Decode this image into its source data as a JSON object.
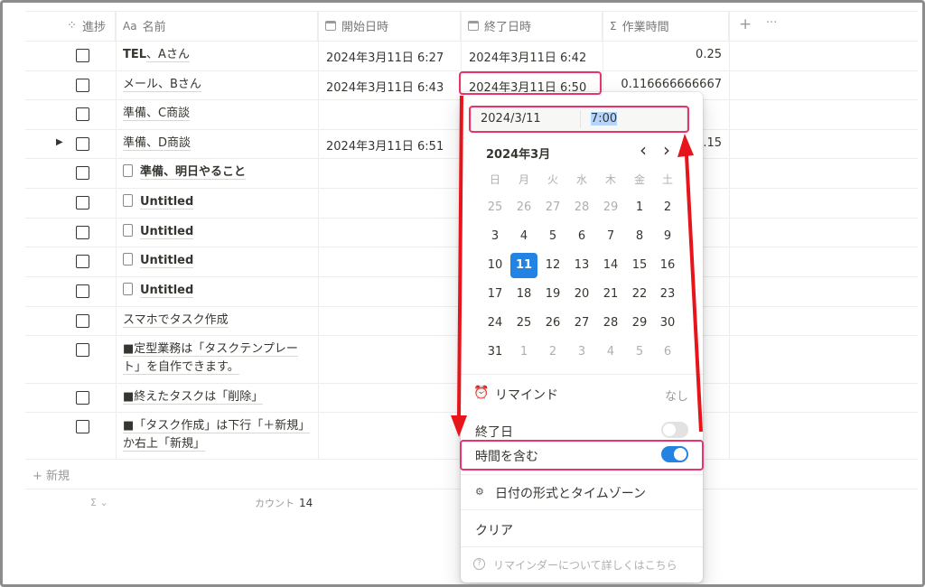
{
  "columns": [
    {
      "icon": "spinner-icon",
      "label": "進捗"
    },
    {
      "icon": "text-icon",
      "icon_text": "Aa",
      "label": "名前"
    },
    {
      "icon": "calendar-icon",
      "label": "開始日時"
    },
    {
      "icon": "calendar-icon",
      "label": "終了日時"
    },
    {
      "icon": "sigma-icon",
      "icon_text": "Σ",
      "label": "作業時間"
    }
  ],
  "add_column": "+",
  "more": "···",
  "rows": [
    {
      "name_bold": "TEL",
      "name": "、Aさん",
      "start": "2024年3月11日 6:27",
      "end": "2024年3月11日 6:42",
      "work": "0.25"
    },
    {
      "name": "メール、Bさん",
      "start": "2024年3月11日 6:43",
      "end": "2024年3月11日 6:50",
      "work": "0.116666666667"
    },
    {
      "name": "準備、C商談",
      "start": "",
      "end": "",
      "work": ""
    },
    {
      "name": "準備、D商談",
      "start": "2024年3月11日 6:51",
      "end": "",
      "work": "0.15",
      "expand": "▶"
    },
    {
      "name": "準備、明日やること",
      "doc": true
    },
    {
      "name": "Untitled",
      "doc": true
    },
    {
      "name": "Untitled",
      "doc": true
    },
    {
      "name": "Untitled",
      "doc": true
    },
    {
      "name": "Untitled",
      "doc": true
    },
    {
      "name": "スマホでタスク作成"
    },
    {
      "name": "■定型業務は「タスクテンプレート」を自作できます。"
    },
    {
      "name": "■終えたタスクは「削除」"
    },
    {
      "name": "■「タスク作成」は下行「＋新規」か右上「新規」"
    }
  ],
  "new_row": "+ 新規",
  "footer": {
    "calc": "Σ ⌄",
    "count_label": "カウント",
    "count": "14"
  },
  "picker": {
    "date": "2024/3/11",
    "time": "7:00",
    "month": "2024年3月",
    "prev": "‹",
    "next": "›",
    "weekdays": [
      "日",
      "月",
      "火",
      "水",
      "木",
      "金",
      "土"
    ],
    "weeks": [
      [
        "25",
        "26",
        "27",
        "28",
        "29",
        "1",
        "2"
      ],
      [
        "3",
        "4",
        "5",
        "6",
        "7",
        "8",
        "9"
      ],
      [
        "10",
        "11",
        "12",
        "13",
        "14",
        "15",
        "16"
      ],
      [
        "17",
        "18",
        "19",
        "20",
        "21",
        "22",
        "23"
      ],
      [
        "24",
        "25",
        "26",
        "27",
        "28",
        "29",
        "30"
      ],
      [
        "31",
        "1",
        "2",
        "3",
        "4",
        "5",
        "6"
      ]
    ],
    "selected": "11",
    "remind": "リマインド",
    "remind_value": "なし",
    "end_date": "終了日",
    "end_date_on": false,
    "include_time": "時間を含む",
    "include_time_on": true,
    "format": "日付の形式とタイムゾーン",
    "clear": "クリア",
    "help": "リマインダーについて詳しくはこちら"
  },
  "colors": {
    "accent": "#2383e2",
    "highlight": "#e8336b",
    "arrow": "#e8141c"
  }
}
